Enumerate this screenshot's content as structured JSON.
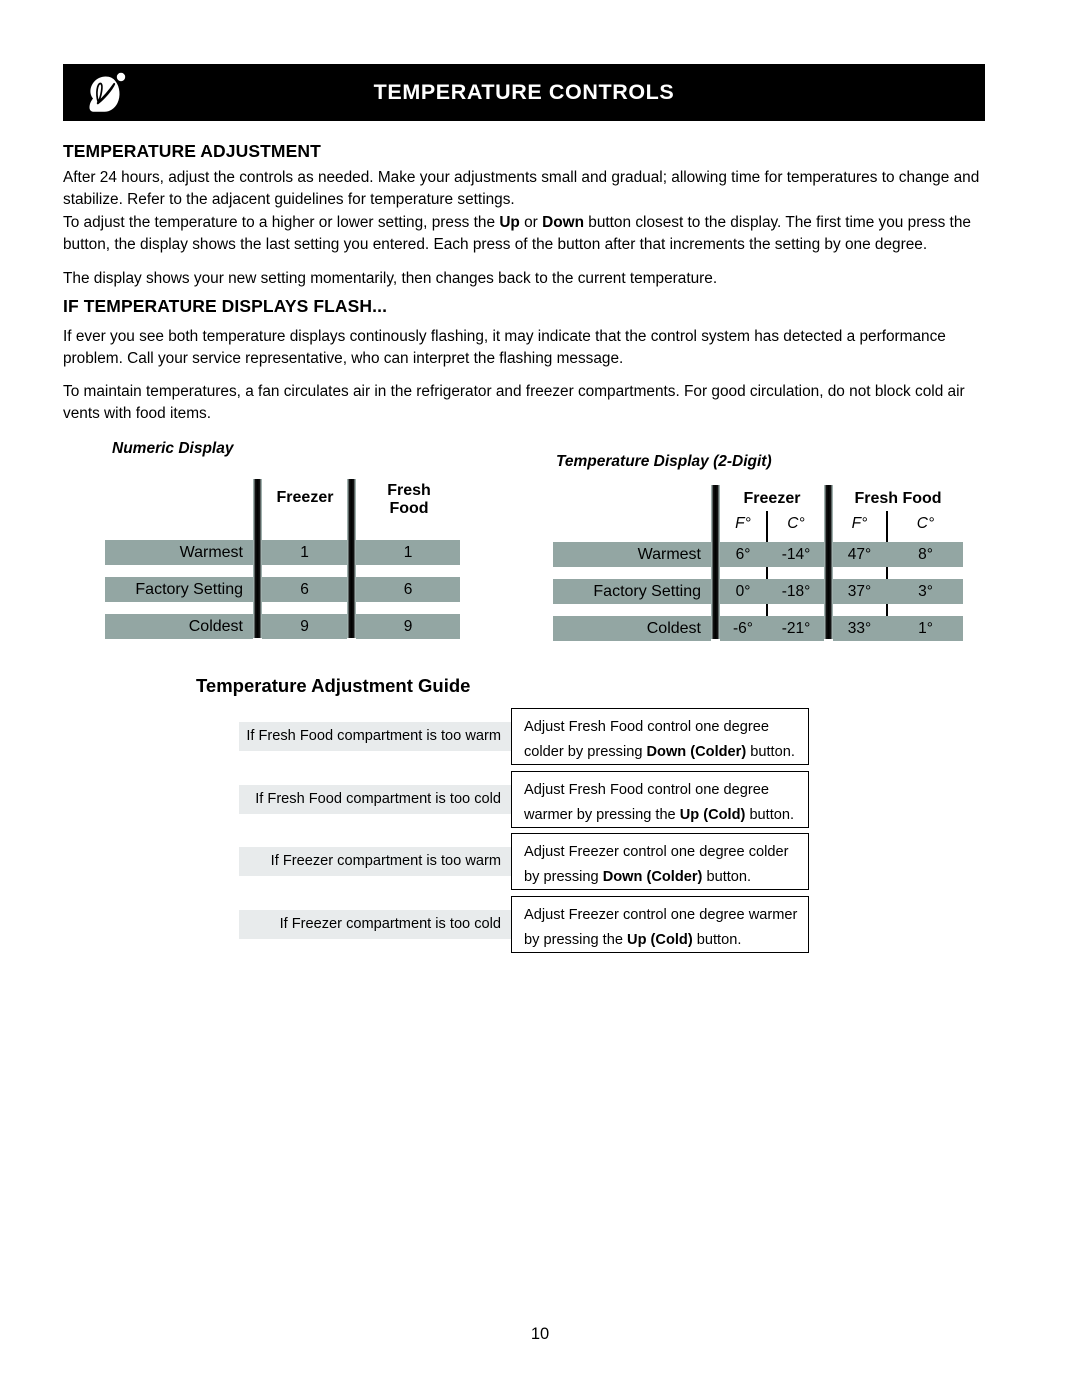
{
  "header": {
    "title": "TEMPERATURE CONTROLS",
    "logo_icon": "leaf-swirl-logo-icon"
  },
  "sections": {
    "adjustment_heading": "TEMPERATURE ADJUSTMENT",
    "flash_heading": "IF TEMPERATURE DISPLAYS FLASH..."
  },
  "paragraphs": {
    "p1_a": "After 24 hours, adjust the controls as needed. Make your adjustments small and gradual; allowing time for temperatures to change and stabilize. Refer to the adjacent guidelines for temperature settings.",
    "p2_pre": "To adjust the temperature to a higher or lower setting, press the ",
    "p2_b1": "Up",
    "p2_mid1": " or ",
    "p2_b2": "Down",
    "p2_post": " button closest to the display. The first time you press the button, the display shows the last setting you entered. Each press of the button after that increments the setting by one degree.",
    "p3": "The display shows your new setting momentarily, then changes back to the current temperature.",
    "p4": "If ever you see both temperature displays continously flashing, it may indicate that the control system has detected a performance problem. Call your service representative, who can interpret the flashing message.",
    "p5": "To maintain temperatures, a fan circulates air in the refrigerator and freezer compartments. For good circulation, do not block cold air vents with food items."
  },
  "numeric_table": {
    "title": "Numeric Display",
    "col_freezer": "Freezer",
    "col_fresh_line1": "Fresh",
    "col_fresh_line2": "Food",
    "rows": [
      {
        "label": "Warmest",
        "freezer": "1",
        "fresh": "1"
      },
      {
        "label": "Factory Setting",
        "freezer": "6",
        "fresh": "6"
      },
      {
        "label": "Coldest",
        "freezer": "9",
        "fresh": "9"
      }
    ]
  },
  "temp_table": {
    "title": "Temperature Display (2-Digit)",
    "group_freezer": "Freezer",
    "group_fresh": "Fresh Food",
    "unit_f": "F°",
    "unit_c": "C°",
    "rows": [
      {
        "label": "Warmest",
        "fz_f": "6°",
        "fz_c": "-14°",
        "ff_f": "47°",
        "ff_c": "8°"
      },
      {
        "label": "Factory Setting",
        "fz_f": "0°",
        "fz_c": "-18°",
        "ff_f": "37°",
        "ff_c": "3°"
      },
      {
        "label": "Coldest",
        "fz_f": "-6°",
        "fz_c": "-21°",
        "ff_f": "33°",
        "ff_c": "1°"
      }
    ]
  },
  "guide": {
    "title": "Temperature Adjustment Guide",
    "rows": [
      {
        "condition": "If Fresh Food compartment is too warm",
        "action_l1": "Adjust Fresh Food control one degree",
        "action_l2_pre": "colder by pressing ",
        "action_l2_bold": "Down (Colder)",
        "action_l2_post": " button."
      },
      {
        "condition": "If Fresh Food compartment is too cold",
        "action_l1": "Adjust Fresh Food control one degree",
        "action_l2_pre": "warmer by pressing the ",
        "action_l2_bold": "Up (Cold)",
        "action_l2_post": " button."
      },
      {
        "condition": "If Freezer compartment is too warm",
        "action_l1": "Adjust Freezer control one degree colder",
        "action_l2_pre": "by pressing ",
        "action_l2_bold": "Down  (Colder)",
        "action_l2_post": " button."
      },
      {
        "condition": "If Freezer compartment is too cold",
        "action_l1": "Adjust Freezer control one degree warmer",
        "action_l2_pre": "by pressing the ",
        "action_l2_bold": "Up  (Cold)",
        "action_l2_post": " button."
      }
    ]
  },
  "footer": {
    "page_number": "10"
  },
  "colors": {
    "header_bg": "#000000",
    "band": "#93a6a3",
    "condition_bg": "#e8ebec"
  }
}
